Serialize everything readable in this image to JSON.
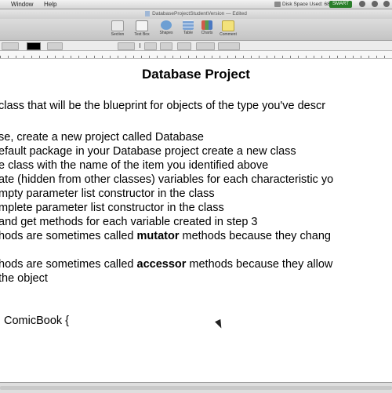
{
  "menubar": {
    "items": [
      "Window",
      "Help"
    ],
    "disk_status": "Disk Space Used: 68%",
    "smart_badge": "SMART"
  },
  "window": {
    "title": "DatabaseProjectStudentVersion — Edited"
  },
  "toolbar": {
    "buttons": [
      "Section",
      "Text Box",
      "Shapes",
      "Table",
      "Charts",
      "Comment"
    ]
  },
  "document": {
    "title": "Database Project",
    "intro": "class that will be the blueprint for objects of the type you've descr",
    "steps": [
      "se, create a new project called Database",
      "efault package in your Database project create a new class",
      "e class with the name of the item you identified above",
      "ate (hidden from other classes) variables for each characteristic yo",
      "mpty parameter list constructor in the class",
      "mplete parameter list constructor in the class",
      "and get methods for each variable created in step 3"
    ],
    "mutator_line": {
      "before": "hods are sometimes called ",
      "bold": "mutator",
      "after": " methods because they chang"
    },
    "accessor_line": {
      "before": "hods are sometimes called ",
      "bold": "accessor",
      "after": " methods because they allow"
    },
    "accessor_cont": "the object",
    "code_line": "ComicBook {"
  }
}
